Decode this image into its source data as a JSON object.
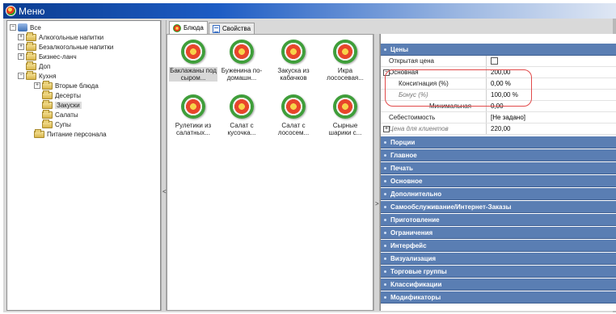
{
  "window": {
    "title": "Меню"
  },
  "tree": {
    "root": "Все",
    "items": [
      {
        "label": "Алкогольные напитки",
        "expander": "+"
      },
      {
        "label": "Безалкогольные напитки",
        "expander": "+"
      },
      {
        "label": "Бизнес-ланч",
        "expander": "+"
      },
      {
        "label": "Доп",
        "expander": ""
      },
      {
        "label": "Кухня",
        "expander": "−"
      },
      {
        "label": "Вторые блюда",
        "expander": "+"
      },
      {
        "label": "Десерты",
        "expander": ""
      },
      {
        "label": "Закуски",
        "expander": ""
      },
      {
        "label": "Салаты",
        "expander": ""
      },
      {
        "label": "Супы",
        "expander": ""
      },
      {
        "label": "Питание персонала",
        "expander": ""
      }
    ]
  },
  "tabs": [
    {
      "label": "Блюда"
    },
    {
      "label": "Свойства"
    }
  ],
  "splitter_glyph": "<",
  "splitter2_glyph": ">",
  "dishes": [
    {
      "label": "Баклажаны под сыром..."
    },
    {
      "label": "Буженина по-домашн..."
    },
    {
      "label": "Закуска из кабачков"
    },
    {
      "label": "Икра лососевая..."
    },
    {
      "label": "Рулетики из салатных..."
    },
    {
      "label": "Салат с кусочка..."
    },
    {
      "label": "Салат с лососем..."
    },
    {
      "label": "Сырные шарики с..."
    }
  ],
  "props": {
    "price_header": "Цены",
    "rows": {
      "open_price": {
        "name": "Открытая цена",
        "value": ""
      },
      "main": {
        "name": "Основная",
        "value": "200,00"
      },
      "consignation": {
        "name": "Консигнация (%)",
        "value": "0,00 %"
      },
      "bonus": {
        "name": "Бонус (%)",
        "value": "100,00 %"
      },
      "minimal": {
        "name": "Минимальная",
        "value": "0,00"
      },
      "cost": {
        "name": "Себестоимость",
        "value": "[Не задано]"
      },
      "client_price": {
        "name": "Цена для клиентов",
        "value": "220,00"
      }
    },
    "main_expander": "−",
    "client_expander": "+",
    "sections": [
      "Порции",
      "Главное",
      "Печать",
      "Основное",
      "Дополнительно",
      "Самообслуживание/Интернет-Заказы",
      "Приготовление",
      "Ограничения",
      "Интерфейс",
      "Визуализация",
      "Торговые группы",
      "Классификации",
      "Модификаторы"
    ]
  },
  "colors": {
    "section_header": "#5a7eb3",
    "highlight": "#e14a4a",
    "titlebar": "#0b3d91"
  }
}
